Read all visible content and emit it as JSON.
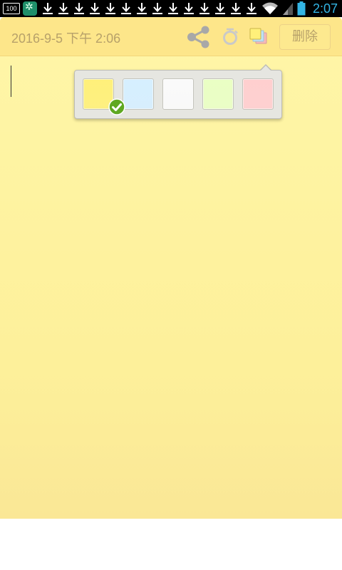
{
  "status_bar": {
    "battery_badge": "100",
    "download_count": 14,
    "time": "2:07",
    "icons": [
      "app-icon",
      "download-icon",
      "wifi-icon",
      "signal-icon",
      "battery-icon"
    ]
  },
  "note": {
    "date": "2016-9-5 下午 2:06",
    "delete_label": "删除",
    "background_color": "#fff6a8",
    "toolbar_icons": [
      "share-icon",
      "alarm-icon",
      "color-icon"
    ]
  },
  "color_picker": {
    "swatches": [
      {
        "name": "yellow",
        "color": "#fff07a",
        "selected": true
      },
      {
        "name": "blue",
        "color": "#d6efff",
        "selected": false
      },
      {
        "name": "white",
        "color": "#fafafa",
        "selected": false
      },
      {
        "name": "green",
        "color": "#eaffc4",
        "selected": false
      },
      {
        "name": "red",
        "color": "#ffcfcf",
        "selected": false
      }
    ]
  }
}
